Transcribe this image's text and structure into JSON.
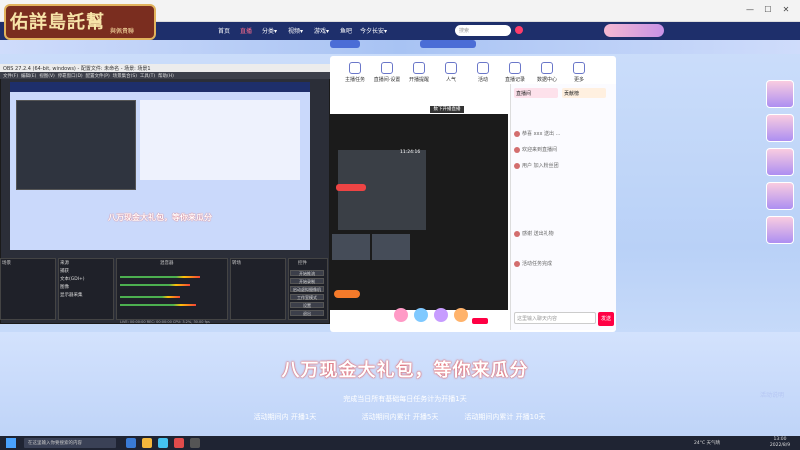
{
  "logo": {
    "title": "佑詳島託幫",
    "subtitle": "與佩貴聯"
  },
  "site_nav": {
    "items": [
      {
        "label": "首页"
      },
      {
        "label": "直播",
        "active": true
      },
      {
        "label": "分类▾"
      },
      {
        "label": "视频▾"
      },
      {
        "label": "游戏▾"
      },
      {
        "label": "鱼吧"
      },
      {
        "label": "今夕长安▾"
      }
    ],
    "search_placeholder": "搜索"
  },
  "room_tools": [
    "主播任务",
    "直播间·设置",
    "开播提醒",
    "人气",
    "活动",
    "直播记录",
    "数据中心",
    "更多"
  ],
  "live_status": "数下开播直播",
  "video_timestamp": "11:24:16",
  "chat": {
    "tabs": [
      "直播间",
      "贡献榜"
    ],
    "lines": [
      "恭喜 xxx 送出 ...",
      "欢迎来到直播间",
      "用户 加入粉丝团",
      "感谢 送出礼物",
      "活动任务完成"
    ],
    "input_placeholder": "这里输入聊天内容",
    "send_label": "发送"
  },
  "obs": {
    "window_title": "OBS 27.2.4 (64-bit, windows) - 配置文件: 未命名 - 场景: 场景1",
    "menu": [
      "文件(F)",
      "编辑(E)",
      "视图(V)",
      "停靠窗口(D)",
      "配置文件(P)",
      "场景集合(S)",
      "工具(T)",
      "帮助(H)"
    ],
    "preview_promo": "八万现金大礼包，等你来瓜分",
    "panels": [
      "场景",
      "来源",
      "混音器",
      "转场",
      "控件"
    ],
    "sources": [
      "捕获",
      "文本(GDI+)",
      "图像",
      "显示器采集"
    ],
    "controls": [
      "开始推流",
      "开始录制",
      "启动虚拟摄像机",
      "工作室模式",
      "设置",
      "退出"
    ],
    "statusbar": "LIVE: 00:00:00  REC: 00:00:00  CPU: 3.2%, 30.00 fps"
  },
  "promo": {
    "title": "八万现金大礼包，等你来瓜分",
    "subtitle": "完成当日所有基础每日任务计为开播1天",
    "steps": [
      "活动期间内 开播1天",
      "活动期间内累计 开播5天",
      "活动期间内累计 开播10天"
    ],
    "tag": "活动说明"
  },
  "taskbar": {
    "search_placeholder": "在这里输入你要搜索的内容",
    "tray": "24°C 天气晴",
    "time": "13:00",
    "date": "2022/8/9"
  },
  "colors": {
    "header_bg": "#1e2f6b",
    "accent": "#ff2a5c",
    "logo_bg": "#7a2d1f",
    "logo_border": "#e1b35d"
  }
}
